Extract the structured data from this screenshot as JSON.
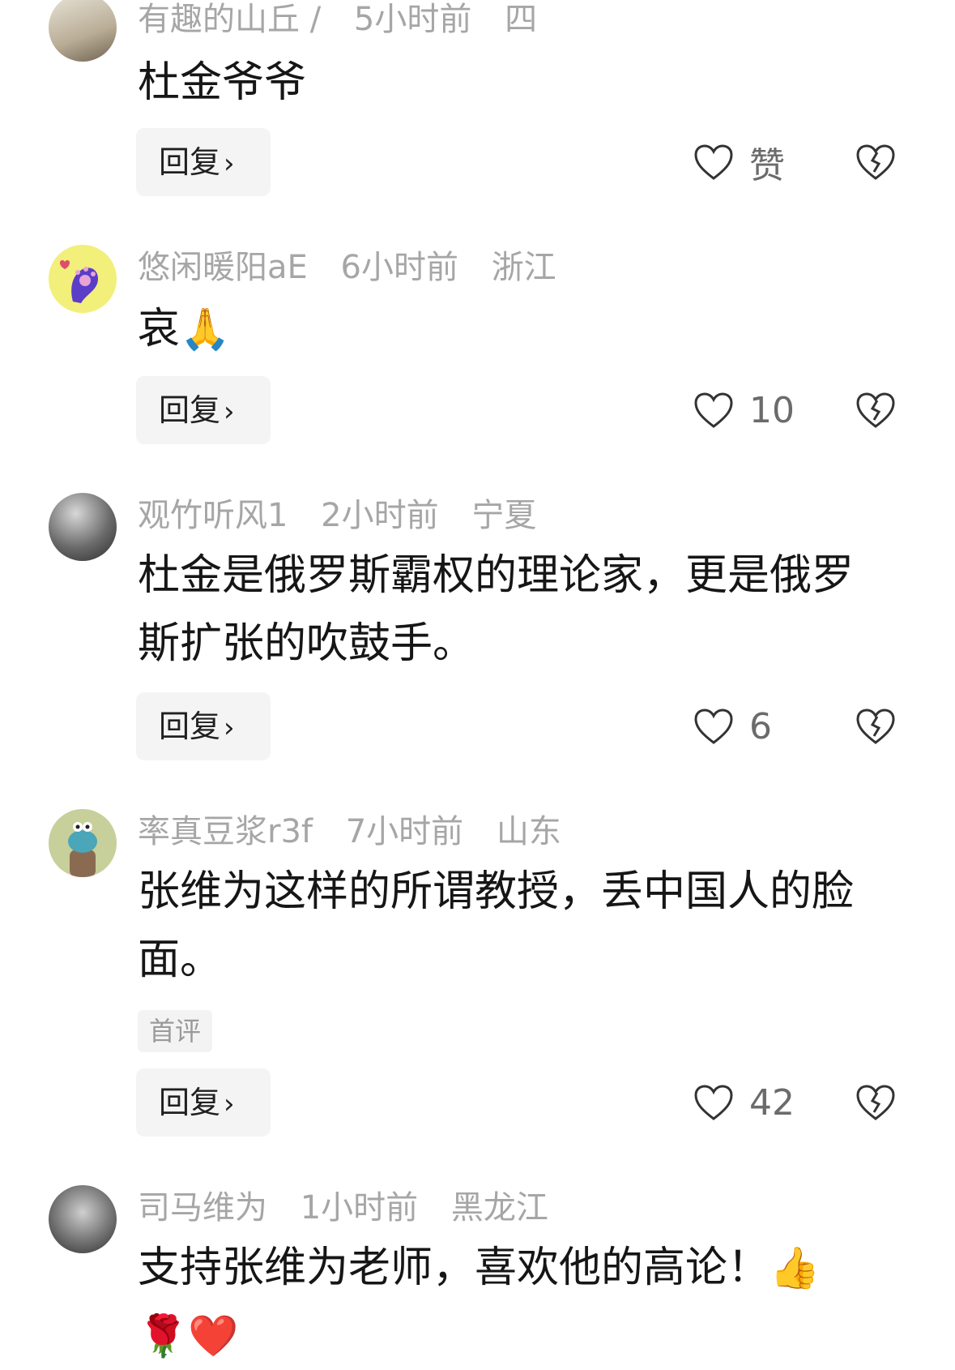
{
  "comments": [
    {
      "username": "有趣的山丘 /",
      "time": "5小时前",
      "location": "四",
      "text": "杜金爷爷",
      "reply_label": "回复",
      "like_label": "赞"
    },
    {
      "username": "悠闲暖阳aE",
      "time": "6小时前",
      "location": "浙江",
      "text": "哀",
      "reply_label": "回复",
      "like_label": "10"
    },
    {
      "username": "观竹听风1",
      "time": "2小时前",
      "location": "宁夏",
      "text": "杜金是俄罗斯霸权的理论家，更是俄罗斯扩张的吹鼓手。",
      "reply_label": "回复",
      "like_label": "6"
    },
    {
      "username": "率真豆浆r3f",
      "time": "7小时前",
      "location": "山东",
      "text": "张维为这样的所谓教授，丢中国人的脸面。",
      "tag": "首评",
      "reply_label": "回复",
      "like_label": "42"
    },
    {
      "username": "司马维为",
      "time": "1小时前",
      "location": "黑龙江",
      "text": "支持张维为老师，喜欢他的高论！"
    }
  ],
  "icons": {
    "reply_chevron": "chevron-right-icon",
    "like": "heart-outline-icon",
    "dislike": "broken-heart-icon"
  }
}
